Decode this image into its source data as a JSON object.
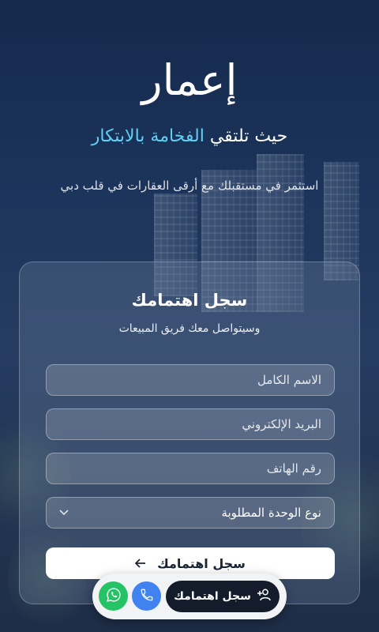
{
  "hero": {
    "brand": "إعمار",
    "tagline_plain": "حيث تلتقي",
    "tagline_accent": "الفخامة بالابتكار",
    "subtitle": "استثمر في مستقبلك مع أرقى العقارات في قلب دبي"
  },
  "form": {
    "title": "سجل اهتمامك",
    "subtitle": "وسيتواصل معك فريق المبيعات",
    "name_placeholder": "الاسم الكامل",
    "email_placeholder": "البريد الإلكتروني",
    "phone_placeholder": "رقم الهاتف",
    "unit_type_selected": "نوع الوحدة المطلوبة",
    "submit_label": "سجل اهتمامك"
  },
  "dock": {
    "cta_label": "سجل اهتمامك"
  },
  "icons": {
    "submit": "arrow-left-icon",
    "select": "chevron-down-icon",
    "cta": "user-plus-icon",
    "phone": "phone-icon",
    "whatsapp": "whatsapp-icon"
  },
  "colors": {
    "accent": "#5fd0f5",
    "phone": "#3f82f0",
    "whatsapp": "#25c366",
    "cta": "#141b2b"
  }
}
